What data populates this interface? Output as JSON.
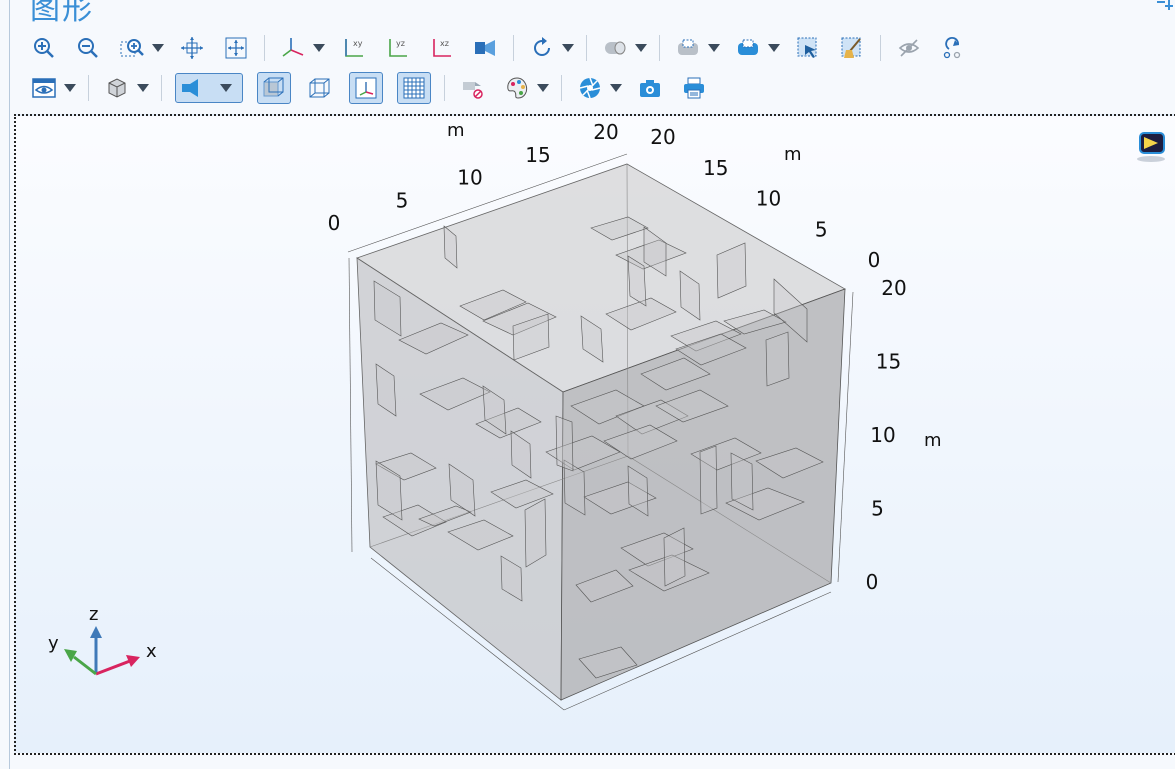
{
  "panel": {
    "title": "图形"
  },
  "toolbar": {
    "row1": [
      {
        "icon": "zoom-in-icon",
        "label": ""
      },
      {
        "icon": "zoom-out-icon",
        "label": ""
      },
      {
        "icon": "zoom-box-icon",
        "label": "",
        "dropdown": true
      },
      {
        "icon": "pan-center-icon",
        "label": ""
      },
      {
        "icon": "zoom-extents-icon",
        "label": ""
      },
      {
        "icon": "default-view-icon",
        "label": "",
        "dropdown": true
      },
      {
        "icon": "xy-view-icon",
        "label": "xy"
      },
      {
        "icon": "yz-view-icon",
        "label": "yz"
      },
      {
        "icon": "xz-view-icon",
        "label": "xz"
      },
      {
        "icon": "camera-projection-icon",
        "label": ""
      },
      {
        "icon": "rotate-icon",
        "label": "",
        "dropdown": true
      },
      {
        "icon": "cylinder-select-icon",
        "label": "",
        "dropdown": true
      },
      {
        "icon": "select-domain-icon",
        "label": "",
        "dropdown": true
      },
      {
        "icon": "select-boundary-icon",
        "label": "",
        "dropdown": true
      },
      {
        "icon": "select-box-icon",
        "label": ""
      },
      {
        "icon": "clear-selection-icon",
        "label": ""
      },
      {
        "icon": "hide-icon",
        "label": ""
      },
      {
        "icon": "reset-hiding-icon",
        "label": ""
      }
    ],
    "row2_labels": {
      "view": "",
      "transparency": "",
      "wireframe": ""
    }
  },
  "axes": {
    "x": {
      "unit": "m",
      "ticks": [
        "0",
        "5",
        "10",
        "15",
        "20"
      ]
    },
    "y": {
      "unit": "m",
      "ticks": [
        "20",
        "15",
        "10",
        "5",
        "0"
      ]
    },
    "z": {
      "unit": "m",
      "ticks": [
        "20",
        "15",
        "10",
        "5",
        "0"
      ]
    }
  },
  "triad": {
    "x": "x",
    "y": "y",
    "z": "z"
  },
  "colors": {
    "accent": "#3a8fd6",
    "toolbar_icon": "#2a6fb8",
    "active_bg": "#c8def4",
    "active_border": "#4a86c5",
    "cube_fill": "#b9b9bb",
    "triad_x": "#d8245f",
    "triad_y": "#4aa648",
    "triad_z": "#3f79b8"
  }
}
